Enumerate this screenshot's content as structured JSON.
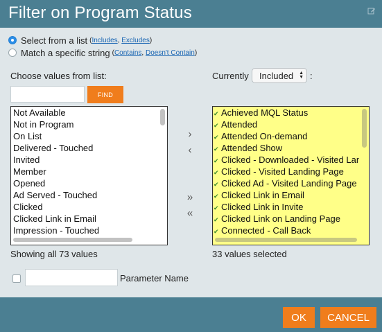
{
  "dialog": {
    "title": "Filter on Program Status"
  },
  "radio": {
    "select_from_list": {
      "label": "Select from a list",
      "paren_open": "(",
      "link1": "Includes",
      "sep": ",",
      "link2": "Excludes",
      "paren_close": ")"
    },
    "match_string": {
      "label": "Match a specific string",
      "paren_open": "(",
      "link1": "Contains",
      "sep": ",",
      "link2": "Doesn't Contain",
      "paren_close": ")"
    }
  },
  "left_panel": {
    "label": "Choose values from list:",
    "find_button": "FIND",
    "search_value": "",
    "items": [
      "Not Available",
      "Not in Program",
      "On List",
      "Delivered - Touched",
      "Invited",
      "Member",
      "Opened",
      "Ad Served - Touched",
      "Clicked",
      "Clicked Link in Email",
      "Impression - Touched"
    ],
    "status": "Showing all 73 values"
  },
  "right_panel": {
    "label_prefix": "Currently",
    "select_value": "Included",
    "label_suffix": ":",
    "items": [
      "Achieved MQL Status",
      "Attended",
      "Attended On-demand",
      "Attended Show",
      "Clicked - Downloaded - Visited Landing Page",
      "Clicked - Visited Landing Page",
      "Clicked Ad - Visited Landing Page",
      "Clicked Link in Email",
      "Clicked Link in Invite",
      "Clicked Link on Landing Page",
      "Connected - Call Back"
    ],
    "status": "33 values selected"
  },
  "transfer": {
    "move_right": "›",
    "move_left": "‹",
    "move_all_right": "»",
    "move_all_left": "«"
  },
  "parameter": {
    "value": "",
    "label": "Parameter Name"
  },
  "footer": {
    "ok": "OK",
    "cancel": "CANCEL"
  },
  "colors": {
    "header_bg": "#4b7f92",
    "body_bg": "#dfe6e9",
    "accent_orange": "#f07d1c",
    "selected_list_bg": "#ffff88",
    "link_blue": "#1a66b3"
  },
  "icons": {
    "edit": "edit-pencil-icon",
    "check": "check-icon"
  }
}
